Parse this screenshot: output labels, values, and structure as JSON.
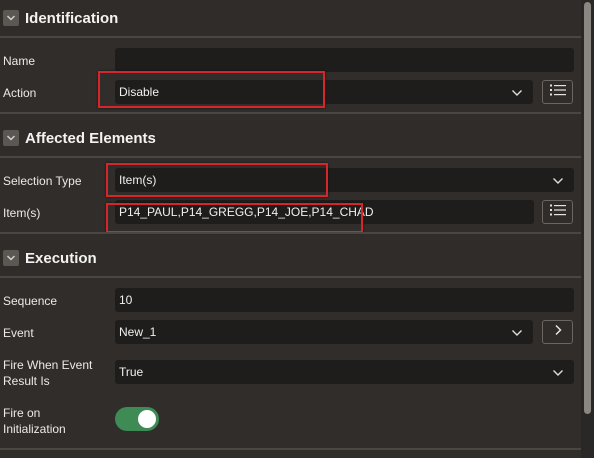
{
  "sections": {
    "identification": {
      "title": "Identification"
    },
    "affected": {
      "title": "Affected Elements"
    },
    "execution": {
      "title": "Execution"
    }
  },
  "identification": {
    "name_label": "Name",
    "name_value": "",
    "action_label": "Action",
    "action_value": "Disable"
  },
  "affected": {
    "selection_type_label": "Selection Type",
    "selection_type_value": "Item(s)",
    "items_label": "Item(s)",
    "items_value": "P14_PAUL,P14_GREGG,P14_JOE,P14_CHAD"
  },
  "execution": {
    "sequence_label": "Sequence",
    "sequence_value": "10",
    "event_label": "Event",
    "event_value": "New_1",
    "fire_when_label_1": "Fire When Event",
    "fire_when_label_2": "Result Is",
    "fire_when_value": "True",
    "fire_on_init_label_1": "Fire on",
    "fire_on_init_label_2": "Initialization",
    "fire_on_init_on": true
  },
  "colors": {
    "highlight": "#d4262b",
    "toggle_on": "#3f8b55",
    "background": "#302d2b",
    "field": "#1f1d1c"
  },
  "icons": {
    "collapse": "chevron-down-icon",
    "list": "list-icon",
    "next": "chevron-right-icon"
  }
}
